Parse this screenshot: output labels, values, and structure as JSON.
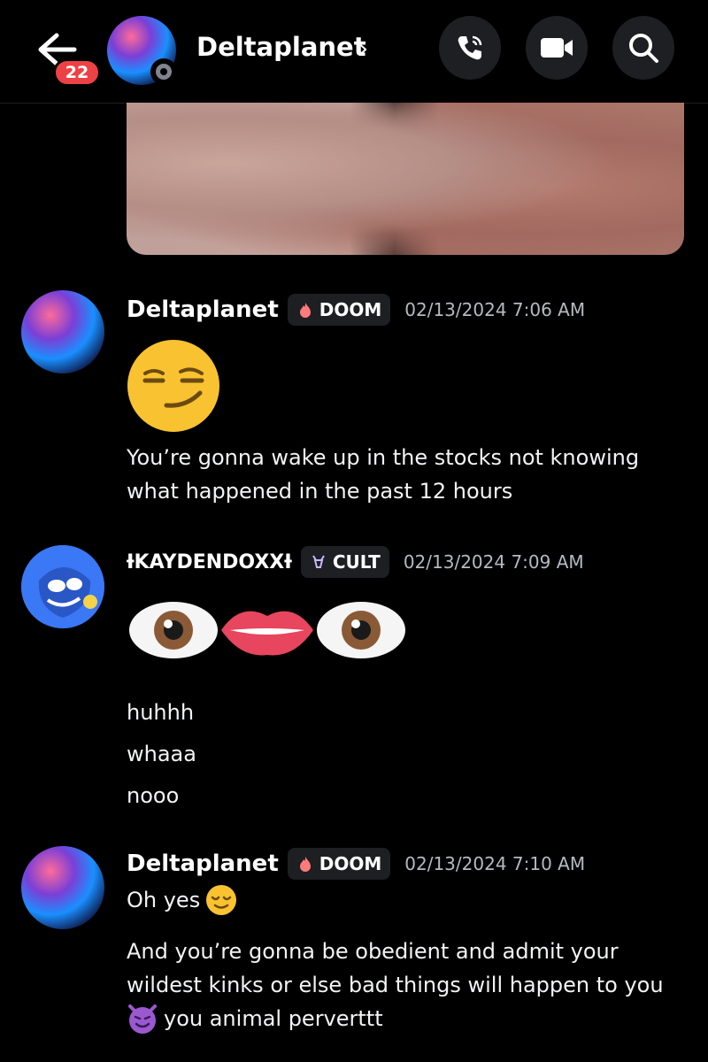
{
  "header": {
    "title": "Deltaplanet",
    "chevron": "›",
    "unread_badge": "22",
    "icons": [
      "back-arrow-icon",
      "phone-call-icon",
      "video-camera-icon",
      "search-icon"
    ]
  },
  "messages": [
    {
      "author": "Deltaplanet",
      "tag": "DOOM",
      "timestamp": "02/13/2024 7:06 AM",
      "emoji": "smirking-face-emoji",
      "lines": [
        "You’re gonna wake up in the stocks not knowing",
        "what happened in the past 12 hours"
      ]
    },
    {
      "author": "ƗKAYDENDOXXƗ",
      "tag": "CULT",
      "timestamp": "02/13/2024 7:09 AM",
      "emoji": "eyes-mouth-eyes-emoji",
      "lines": [
        "huhhh",
        "whaaa",
        "nooo"
      ]
    },
    {
      "author": "Deltaplanet",
      "tag": "DOOM",
      "timestamp": "02/13/2024 7:10 AM",
      "first_line": "Oh yes",
      "lines": [
        "And you’re gonna be obedient and admit your",
        "wildest kinks or else bad things will happen to you"
      ],
      "last_line": "you animal perverttt"
    }
  ]
}
